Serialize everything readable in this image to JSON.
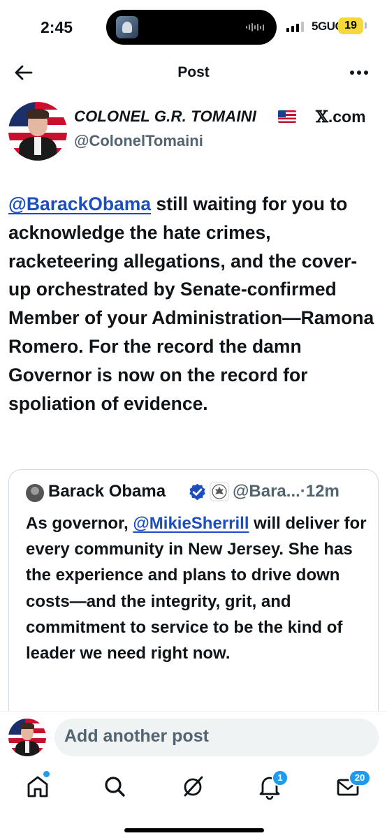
{
  "status_bar": {
    "time": "2:45",
    "network": "5GUC",
    "battery": "19"
  },
  "header": {
    "title": "Post"
  },
  "post": {
    "author_name": "COLONEL G.R. TOMAINI",
    "author_handle": "@ColonelTomaini",
    "source": ".com",
    "source_mark": "𝕏",
    "text": {
      "mention": "@BarackObama",
      "body": " still waiting for you to acknowledge the hate crimes, racketeering allegations, and the cover-up orchestrated by Senate-confirmed Member of your Administration—Ramona Romero. For the record the damn Governor is now on the record for spoliation of evidence."
    }
  },
  "quoted_post": {
    "author_name": "Barack Obama",
    "author_handle": "@Bara...",
    "separator": "·",
    "time": "12m",
    "text_before": "As governor, ",
    "mention": "@MikieSherrill",
    "text_after": " will deliver for every community in New Jersey. She has the experience and plans to drive down costs—and the integrity, grit, and commitment to service to be the kind of leader we need right now."
  },
  "composer": {
    "placeholder": "Add another post"
  },
  "tabbar": {
    "notifications_badge": "1",
    "messages_badge": "20"
  },
  "colors": {
    "text": "#0f1419",
    "secondary": "#536471",
    "mention": "#1d4ebf",
    "accent": "#1d9bf0",
    "battery": "#f5d83a"
  },
  "icons": [
    "back-arrow-icon",
    "more-icon",
    "verified-icon",
    "seal-icon",
    "home-icon",
    "search-icon",
    "grok-icon",
    "bell-icon",
    "mail-icon"
  ]
}
